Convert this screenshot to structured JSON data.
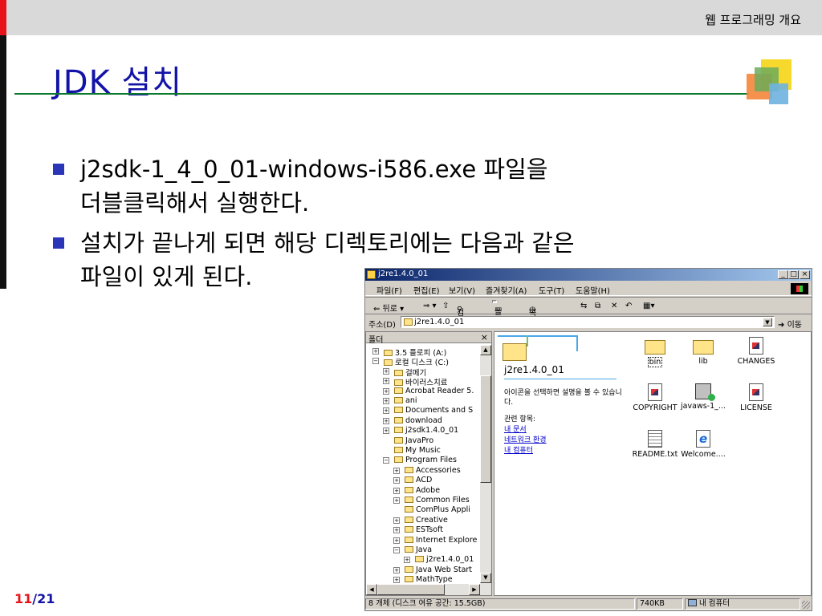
{
  "slide": {
    "header": "웹 프로그래밍 개요",
    "title": "JDK 설치",
    "bullets": [
      {
        "line1": "j2sdk-1_4_0_01-windows-i586.exe 파일을",
        "line2": "더블클릭해서 실행한다."
      },
      {
        "line1": "설치가 끝나게 되면 해당 디렉토리에는 다음과 같은",
        "line2": "파일이 있게 된다."
      }
    ],
    "page_current": "11",
    "page_sep_total": "/21",
    "colors": {
      "title": "#1313a8",
      "accent_red": "#e8141b",
      "rule_green": "#0b7a2c",
      "bullet": "#2a35b8"
    }
  },
  "explorer": {
    "title": "j2re1.4.0_01",
    "controls": {
      "minimize": "_",
      "maximize": "□",
      "close": "×"
    },
    "menu": [
      "파일(F)",
      "편집(E)",
      "보기(V)",
      "즐겨찾기(A)",
      "도구(T)",
      "도움말(H)"
    ],
    "toolbar": {
      "back": "⇐ 뒤로 ▾",
      "forward": "⇒ ▾",
      "up": "⇧",
      "search": "검색",
      "folders": "폴더",
      "history": "목록보기",
      "move": "⇆",
      "copy": "⧉",
      "delete": "✕",
      "undo": "↶",
      "views": "▦▾"
    },
    "address": {
      "label": "주소(D)",
      "value": "j2re1.4.0_01",
      "go": "이동"
    },
    "folders_pane": {
      "title": "폴더",
      "close": "×",
      "tree": [
        {
          "label": "3.5 플로피 (A:)",
          "level": 1,
          "exp": "+"
        },
        {
          "label": "로컬 디스크 (C:)",
          "level": 1,
          "exp": "−"
        },
        {
          "label": "걸메기",
          "level": 2,
          "exp": "+"
        },
        {
          "label": "바이러스치료",
          "level": 2,
          "exp": "+"
        },
        {
          "label": "Acrobat Reader 5.",
          "level": 2,
          "exp": "+"
        },
        {
          "label": "ani",
          "level": 2,
          "exp": "+"
        },
        {
          "label": "Documents and S",
          "level": 2,
          "exp": "+"
        },
        {
          "label": "download",
          "level": 2,
          "exp": "+"
        },
        {
          "label": "j2sdk1.4.0_01",
          "level": 2,
          "exp": "+"
        },
        {
          "label": "JavaPro",
          "level": 2,
          "exp": ""
        },
        {
          "label": "My Music",
          "level": 2,
          "exp": ""
        },
        {
          "label": "Program Files",
          "level": 2,
          "exp": "−"
        },
        {
          "label": "Accessories",
          "level": 3,
          "exp": "+"
        },
        {
          "label": "ACD",
          "level": 3,
          "exp": "+"
        },
        {
          "label": "Adobe",
          "level": 3,
          "exp": "+"
        },
        {
          "label": "Common Files",
          "level": 3,
          "exp": "+"
        },
        {
          "label": "ComPlus Appli",
          "level": 3,
          "exp": ""
        },
        {
          "label": "Creative",
          "level": 3,
          "exp": "+"
        },
        {
          "label": "ESTsoft",
          "level": 3,
          "exp": "+"
        },
        {
          "label": "Internet Explore",
          "level": 3,
          "exp": "+"
        },
        {
          "label": "Java",
          "level": 3,
          "exp": "−"
        },
        {
          "label": "j2re1.4.0_01",
          "level": 4,
          "exp": "+"
        },
        {
          "label": "Java Web Start",
          "level": 3,
          "exp": "+"
        },
        {
          "label": "MathType",
          "level": 3,
          "exp": "+"
        }
      ]
    },
    "web_view": {
      "title": "j2re1.4.0_01",
      "desc": "아이콘을 선택하면 설명을 볼 수 있습니다.",
      "related": "관련 항목:",
      "links": [
        "내 문서",
        "네트워크 환경",
        "내 컴퓨터"
      ]
    },
    "files": [
      {
        "label": "bin",
        "type": "folder",
        "dotted": true
      },
      {
        "label": "lib",
        "type": "folder",
        "dotted": false
      },
      {
        "label": "CHANGES",
        "type": "doc",
        "dotted": false
      },
      {
        "label": "COPYRIGHT",
        "type": "doc",
        "dotted": false
      },
      {
        "label": "javaws-1_...",
        "type": "app",
        "dotted": false
      },
      {
        "label": "LICENSE",
        "type": "doc",
        "dotted": false
      },
      {
        "label": "README.txt",
        "type": "txt",
        "dotted": false
      },
      {
        "label": "Welcome....",
        "type": "ie",
        "dotted": false
      }
    ],
    "status": {
      "objects": "8 개체 (디스크 여유 공간: 15.5GB)",
      "size": "740KB",
      "zone": "내 컴퓨터"
    }
  }
}
